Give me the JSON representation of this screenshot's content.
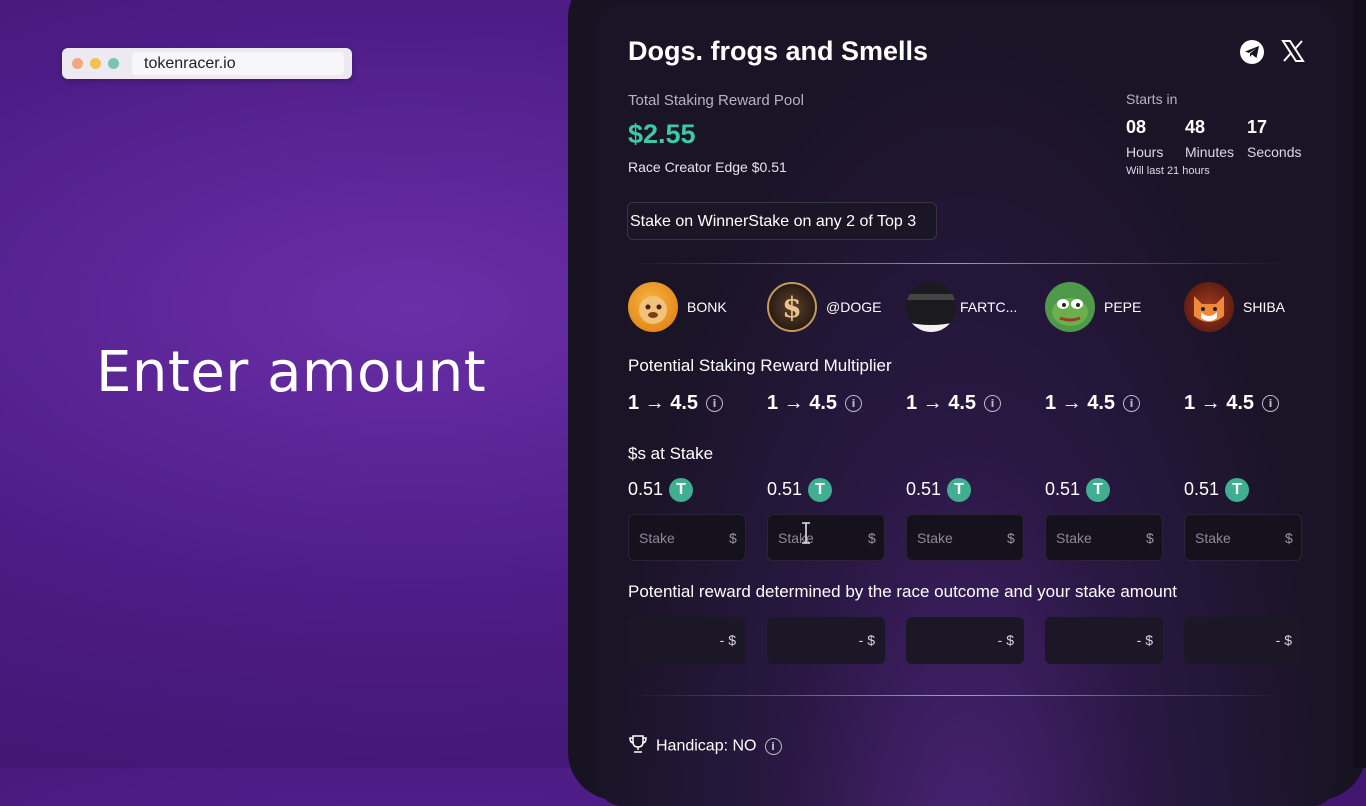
{
  "browser": {
    "url": "tokenracer.io"
  },
  "hero": {
    "text": "Enter amount"
  },
  "race": {
    "title": "Dogs. frogs and Smells",
    "social": {
      "telegram_icon": "telegram-icon",
      "x_icon": "x-logo-icon"
    },
    "pool": {
      "label": "Total Staking Reward Pool",
      "value": "$2.55",
      "edge": "Race Creator Edge $0.51",
      "value_color": "#3fc9a3"
    },
    "countdown": {
      "label": "Starts in",
      "hours": "08",
      "hours_label": "Hours",
      "minutes": "48",
      "minutes_label": "Minutes",
      "seconds": "17",
      "seconds_label": "Seconds",
      "duration": "Will last 21 hours"
    },
    "stake_rule": "Stake on WinnerStake on any 2 of Top 3",
    "sections": {
      "multiplier": "Potential Staking Reward Multiplier",
      "stakes": "$s at Stake",
      "reward": "Potential reward determined by the race outcome and your stake amount"
    },
    "tokens": [
      {
        "name": "BONK",
        "multiplier": "1 → 4.5",
        "staked": "0.51",
        "input_placeholder": "Stake",
        "currency": "$",
        "reward": "- $"
      },
      {
        "name": "@DOGE",
        "multiplier": "1 → 4.5",
        "staked": "0.51",
        "input_placeholder": "Stake",
        "currency": "$",
        "reward": "- $"
      },
      {
        "name": "FARTC...",
        "multiplier": "1 → 4.5",
        "staked": "0.51",
        "input_placeholder": "Stake",
        "currency": "$",
        "reward": "- $"
      },
      {
        "name": "PEPE",
        "multiplier": "1 → 4.5",
        "staked": "0.51",
        "input_placeholder": "Stake",
        "currency": "$",
        "reward": "- $"
      },
      {
        "name": "SHIBA",
        "multiplier": "1 → 4.5",
        "staked": "0.51",
        "input_placeholder": "Stake",
        "currency": "$",
        "reward": "- $"
      }
    ],
    "tether_symbol": "T",
    "info_symbol": "i",
    "handicap": "Handicap: NO"
  }
}
